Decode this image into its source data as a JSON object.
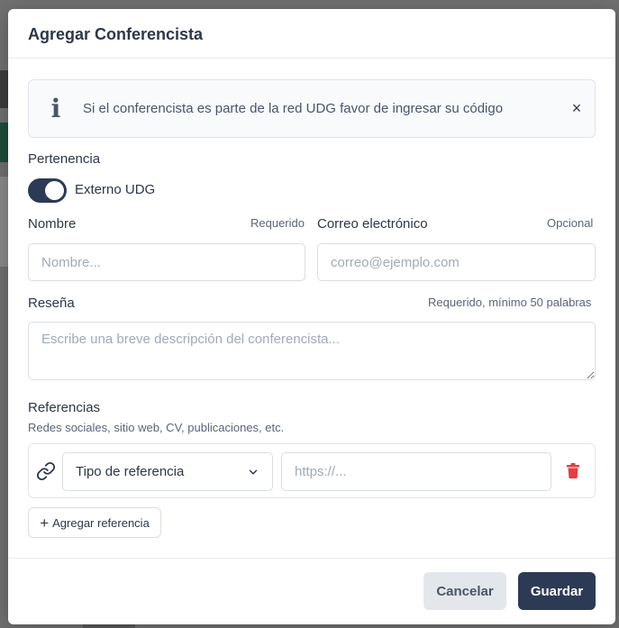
{
  "dialog": {
    "title": "Agregar Conferencista"
  },
  "alert": {
    "icon": "info-icon",
    "text": "Si el conferencista es parte de la red UDG favor de ingresar su código",
    "close": "×"
  },
  "pertenencia": {
    "label": "Pertenencia",
    "toggle_on": true,
    "toggle_label": "Externo UDG"
  },
  "nombre": {
    "label": "Nombre",
    "hint": "Requerido",
    "placeholder": "Nombre...",
    "value": ""
  },
  "correo": {
    "label": "Correo electrónico",
    "hint": "Opcional",
    "placeholder": "correo@ejemplo.com",
    "value": ""
  },
  "resena": {
    "label": "Reseña",
    "hint": "Requerido, mínimo 50 palabras",
    "placeholder": "Escribe una breve descripción del conferencista...",
    "value": ""
  },
  "referencias": {
    "label": "Referencias",
    "subtitle": "Redes sociales, sitio web, CV, publicaciones, etc.",
    "items": [
      {
        "type_selected": "Tipo de referencia",
        "url_placeholder": "https://...",
        "url_value": ""
      }
    ],
    "add_label": "Agregar referencia",
    "add_icon": "+"
  },
  "footer": {
    "cancel_label": "Cancelar",
    "save_label": "Guardar"
  },
  "colors": {
    "primary": "#2d3a55",
    "danger": "#e53e3e",
    "overlay": "#707070"
  }
}
